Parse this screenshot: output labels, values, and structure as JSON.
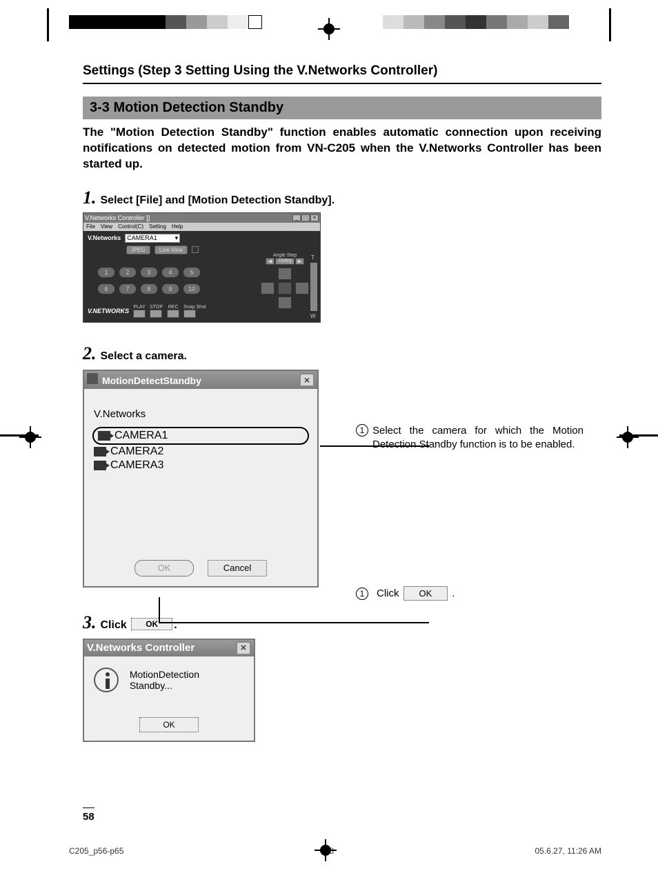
{
  "header": {
    "breadcrumb": "Settings (Step 3 Setting Using the V.Networks Controller)"
  },
  "section": {
    "title": "3-3 Motion Detection Standby",
    "intro": "The \"Motion Detection Standby\" function enables automatic connection upon receiving notifications on detected motion from VN-C205 when the V.Networks Controller has been started up."
  },
  "steps": {
    "s1": {
      "num": "1.",
      "text": "Select [File] and [Motion Detection Standby]."
    },
    "s2": {
      "num": "2.",
      "text": "Select a camera."
    },
    "s3": {
      "num": "3.",
      "text_before": "Click ",
      "btn": "OK",
      "text_after": "."
    }
  },
  "controller_window": {
    "title": "V.Networks Controller []",
    "menu": [
      "File",
      "View",
      "Control(C)",
      "Setting",
      "Help"
    ],
    "vnetworks_label": "V.Networks",
    "camera_combo": "CAMERA1",
    "jpeg_btn": "JPEG",
    "liveview_btn": "Live View",
    "presets_row1": [
      "1",
      "2",
      "3",
      "4",
      "5"
    ],
    "presets_row2": [
      "6",
      "7",
      "8",
      "9",
      "10"
    ],
    "transport": {
      "play": "PLAY",
      "stop": "STOP",
      "rec": "REC",
      "snap": "Snap Shot"
    },
    "logo": "V.NETWORKS",
    "angle_step_label": "Angle Step",
    "angle_step_value": "10deg"
  },
  "motion_dialog": {
    "title": "MotionDetectStandby",
    "group_label": "V.Networks",
    "cameras": [
      "CAMERA1",
      "CAMERA2",
      "CAMERA3"
    ],
    "ok": "OK",
    "cancel": "Cancel"
  },
  "annotations": {
    "a1_num": "1",
    "a1_text": "Select the camera for which the Motion Detection Standby function is to be enabled.",
    "a2_num": "1",
    "a2_text_before": "Click ",
    "a2_btn": "OK",
    "a2_text_after": " ."
  },
  "confirm_dialog": {
    "title": "V.Networks Controller",
    "message": "MotionDetection Standby...",
    "ok": "OK"
  },
  "footer": {
    "page_number": "58",
    "doc_id": "C205_p56-p65",
    "sheet": "58",
    "timestamp": "05.6.27, 11:26 AM"
  }
}
